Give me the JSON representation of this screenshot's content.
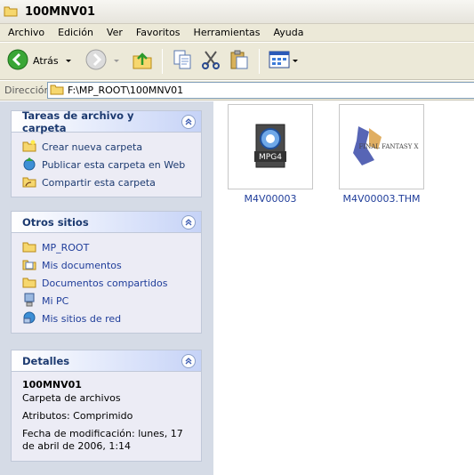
{
  "window": {
    "title": "100MNV01"
  },
  "menu": [
    "Archivo",
    "Edición",
    "Ver",
    "Favoritos",
    "Herramientas",
    "Ayuda"
  ],
  "toolbar": {
    "back_label": "Atrás"
  },
  "address": {
    "label": "Dirección",
    "path": "F:\\MP_ROOT\\100MNV01"
  },
  "tasks_panel": {
    "title": "Tareas de archivo y carpeta",
    "items": [
      {
        "label": "Crear nueva carpeta",
        "icon": "new-folder-icon"
      },
      {
        "label": "Publicar esta carpeta en Web",
        "icon": "publish-web-icon"
      },
      {
        "label": "Compartir esta carpeta",
        "icon": "share-folder-icon"
      }
    ]
  },
  "other_places": {
    "title": "Otros sitios",
    "items": [
      {
        "label": "MP_ROOT",
        "icon": "folder-icon"
      },
      {
        "label": "Mis documentos",
        "icon": "my-documents-icon"
      },
      {
        "label": "Documentos compartidos",
        "icon": "shared-documents-icon"
      },
      {
        "label": "Mi PC",
        "icon": "my-computer-icon"
      },
      {
        "label": "Mis sitios de red",
        "icon": "network-places-icon"
      }
    ]
  },
  "details": {
    "title": "Detalles",
    "name": "100MNV01",
    "type": "Carpeta de archivos",
    "attributes": "Atributos: Comprimido",
    "modified": "Fecha de modificación: lunes, 17 de abril de 2006, 1:14"
  },
  "files": [
    {
      "name": "M4V00003",
      "thumb_label": "MPG4",
      "icon": "mpeg4-video-icon"
    },
    {
      "name": "M4V00003.THM",
      "thumb_label": "FINAL FANTASY X",
      "icon": "thumbnail-image-icon"
    }
  ],
  "colors": {
    "pane_bg": "#d5dbe6",
    "link": "#1f3d9a",
    "heading": "#1c3a70",
    "back_green": "#3aa636"
  }
}
